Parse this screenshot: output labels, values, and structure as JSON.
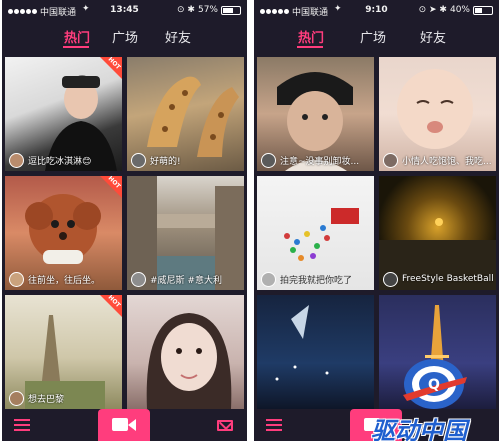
{
  "left_phone": {
    "status": {
      "carrier": "中国联通",
      "wifi": "✦",
      "time": "13:45",
      "extra": "⊙ ✱",
      "battery": "57%",
      "battery_level": 0.57
    },
    "tabs": [
      {
        "label": "热门"
      },
      {
        "label": "广场"
      },
      {
        "label": "好友"
      }
    ],
    "cards": [
      {
        "caption": "逗比吃冰淇淋😊",
        "hot": "HOT"
      },
      {
        "caption": "好萌的!"
      },
      {
        "caption": "往前坐，往后坐。",
        "hot": "HOT"
      },
      {
        "caption": "#威尼斯 #意大利"
      },
      {
        "caption": "想去巴黎",
        "hot": "HOT"
      },
      {
        "caption": ""
      }
    ]
  },
  "right_phone": {
    "status": {
      "carrier": "中国联通",
      "wifi": "✦",
      "time": "9:10",
      "extra": "⊙ ➤ ✱",
      "battery": "40%",
      "battery_level": 0.4
    },
    "tabs": [
      {
        "label": "热门"
      },
      {
        "label": "广场"
      },
      {
        "label": "好友"
      }
    ],
    "cards": [
      {
        "caption": "注意~没事别卸妆..."
      },
      {
        "caption": "小情人吃饱饱、我吃..."
      },
      {
        "caption": "拍完我就把你吃了"
      },
      {
        "caption": "FreeStyle BasketBall"
      },
      {
        "caption": ""
      },
      {
        "caption": ""
      }
    ]
  },
  "watermark": {
    "text": "驱动中国",
    "logo_letter": "Q"
  },
  "colors": {
    "accent": "#ff3d7d",
    "background": "#1e1b2a",
    "hot_badge": "#ff4b3a"
  }
}
